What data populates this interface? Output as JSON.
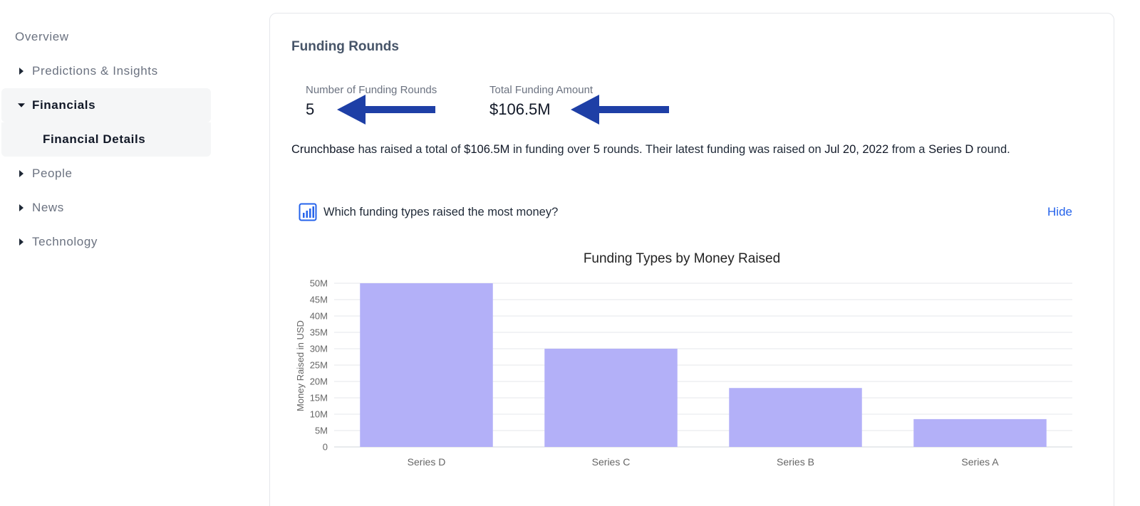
{
  "sidebar": {
    "items": [
      {
        "label": "Overview",
        "caret": "none"
      },
      {
        "label": "Predictions & Insights",
        "caret": "right"
      },
      {
        "label": "Financials",
        "caret": "down"
      },
      {
        "label": "Financial Details",
        "caret": "none"
      },
      {
        "label": "People",
        "caret": "right"
      },
      {
        "label": "News",
        "caret": "right"
      },
      {
        "label": "Technology",
        "caret": "right"
      }
    ]
  },
  "card": {
    "title": "Funding Rounds",
    "stats": [
      {
        "label": "Number of Funding Rounds",
        "value": "5"
      },
      {
        "label": "Total Funding Amount",
        "value": "$106.5M"
      }
    ],
    "summary": {
      "company": "Crunchbase",
      "t1": " has raised a total of ",
      "amount": "$106.5M",
      "t2": " in funding over ",
      "rounds": "5",
      "t3": " rounds. Their latest funding was raised on ",
      "date": "Jul 20, 2022",
      "t4": " from a ",
      "round_type": "Series D",
      "t5": " round."
    },
    "insight": {
      "icon": "bar-chart-icon",
      "question": "Which funding types raised the most money?",
      "hide_label": "Hide"
    }
  },
  "colors": {
    "arrow": "#1e3fa6",
    "bar": "#b3b0f8",
    "link": "#2563eb"
  },
  "chart_data": {
    "type": "bar",
    "title": "Funding Types by Money Raised",
    "ylabel": "Money Raised in USD",
    "xlabel": "",
    "categories": [
      "Series D",
      "Series C",
      "Series B",
      "Series A"
    ],
    "values": [
      50000000,
      30000000,
      18000000,
      8500000
    ],
    "ylim": [
      0,
      50000000
    ],
    "yticks": [
      "0",
      "5M",
      "10M",
      "15M",
      "20M",
      "25M",
      "30M",
      "35M",
      "40M",
      "45M",
      "50M"
    ],
    "grid": true,
    "legend": "none"
  }
}
